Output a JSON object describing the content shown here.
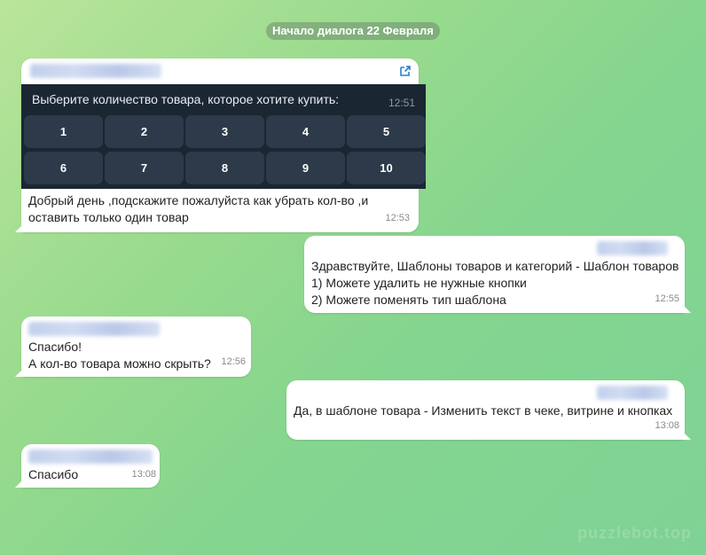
{
  "date_separator": "Начало диалога 22 Февраля",
  "colors": {
    "accent": "#2b7fd6",
    "keyboard_bg": "#1b2633",
    "key_bg": "#2c3a4a"
  },
  "messages": [
    {
      "direction": "incoming",
      "keyboard": {
        "title": "Выберите количество товара, которое хотите купить:",
        "time": "12:51",
        "rows": [
          [
            "1",
            "2",
            "3",
            "4",
            "5"
          ],
          [
            "6",
            "7",
            "8",
            "9",
            "10"
          ]
        ]
      },
      "line1": "Добрый день ,подскажите пожалуйста как  убрать кол-во ,и",
      "line2": "оставить только один товар",
      "time": "12:53"
    },
    {
      "direction": "outgoing",
      "line1": "Здравствуйте, Шаблоны товаров и категорий - Шаблон товаров",
      "line2": "1) Можете удалить не нужные кнопки",
      "line3": "2) Можете поменять тип шаблона",
      "time": "12:55"
    },
    {
      "direction": "incoming",
      "line1": "Спасибо!",
      "line2": "А кол-во товара можно скрыть?",
      "time": "12:56"
    },
    {
      "direction": "outgoing",
      "line1": "Да, в шаблоне товара - Изменить текст в чеке, витрине и кнопках",
      "time": "13:08"
    },
    {
      "direction": "incoming",
      "line1": "Спасибо",
      "time": "13:08"
    }
  ],
  "icons": {
    "open_link": "external-link-icon"
  },
  "watermark": "puzzlebot.top"
}
